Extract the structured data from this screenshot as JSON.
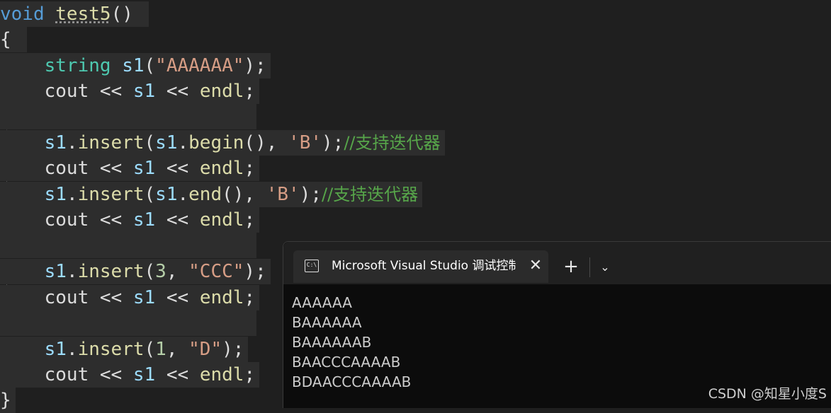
{
  "editor": {
    "lines": {
      "l0": {
        "kw_void": "void",
        "fn_name": "test5",
        "parens": "()"
      },
      "l1": {
        "brace_open": "{"
      },
      "l2": {
        "type": "string",
        "var": "s1",
        "open": "(",
        "str": "\"AAAAAA\"",
        "close": ");"
      },
      "l3": {
        "cout": "cout",
        "op1": " << ",
        "var": "s1",
        "op2": " << ",
        "endl": "endl",
        "semi": ";"
      },
      "l5": {
        "var1": "s1",
        "dot": ".",
        "fn": "insert",
        "open": "(",
        "var2": "s1",
        "dot2": ".",
        "fn2": "begin",
        "args": "(), ",
        "str": "'B'",
        "close": ");",
        "comment": "//支持迭代器"
      },
      "l6": {
        "cout": "cout",
        "op1": " << ",
        "var": "s1",
        "op2": " << ",
        "endl": "endl",
        "semi": ";"
      },
      "l7": {
        "var1": "s1",
        "dot": ".",
        "fn": "insert",
        "open": "(",
        "var2": "s1",
        "dot2": ".",
        "fn2": "end",
        "args": "(), ",
        "str": "'B'",
        "close": ");",
        "comment": "//支持迭代器"
      },
      "l8": {
        "cout": "cout",
        "op1": " << ",
        "var": "s1",
        "op2": " << ",
        "endl": "endl",
        "semi": ";"
      },
      "l10": {
        "var1": "s1",
        "dot": ".",
        "fn": "insert",
        "open": "(",
        "num": "3",
        "comma": ", ",
        "str": "\"CCC\"",
        "close": ");"
      },
      "l11": {
        "cout": "cout",
        "op1": " << ",
        "var": "s1",
        "op2": " << ",
        "endl": "endl",
        "semi": ";"
      },
      "l13": {
        "var1": "s1",
        "dot": ".",
        "fn": "insert",
        "open": "(",
        "num": "1",
        "comma": ", ",
        "str": "\"D\"",
        "close": ");"
      },
      "l14": {
        "cout": "cout",
        "op1": " << ",
        "var": "s1",
        "op2": " << ",
        "endl": "endl",
        "semi": ";"
      },
      "l15": {
        "brace_close": "}"
      }
    }
  },
  "terminal": {
    "tab_title": "Microsoft Visual Studio 调试控制台",
    "tab_icon_text": "C:\\",
    "close_glyph": "✕",
    "new_tab_glyph": "+",
    "dropdown_glyph": "⌄",
    "output": [
      "AAAAAA",
      "BAAAAAA",
      "BAAAAAAB",
      "BAACCCAAAAB",
      "BDAACCCAAAAB"
    ]
  },
  "watermark": "CSDN @知星小度S"
}
